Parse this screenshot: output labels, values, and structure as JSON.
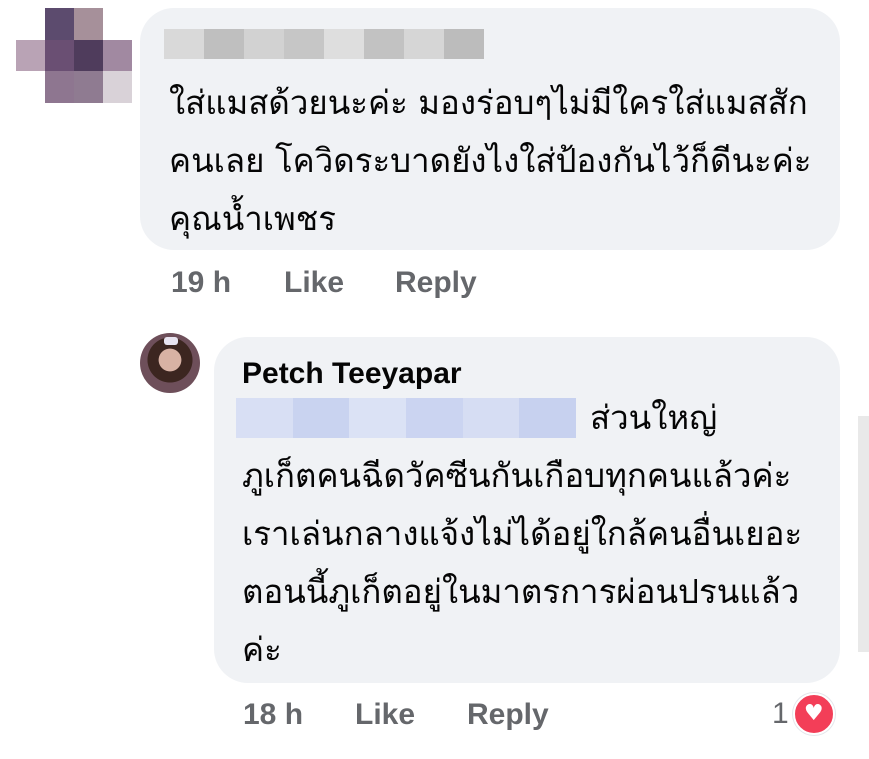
{
  "comment": {
    "text": "ใส่แมสด้วยนะค่ะ มองร่อบๆไม่มีใครใส่แมสสักคนเลย โควิดระบาดยังไงใส่ป้องกันไว้ก็ดีนะค่ะ คุณน้ำเพชร",
    "time": "19 h",
    "like_label": "Like",
    "reply_label": "Reply"
  },
  "reply": {
    "author": "Petch Teeyapar",
    "text_first_line": "ส่วนใหญ่",
    "text": "ภูเก็ตคนฉีดวัคซีนกันเกือบทุกคนแล้วค่ะเราเล่นกลางแจ้งไม่ได้อยู่ใกล้คนอื่นเยอะตอนนี้ภูเก็ตอยู่ในมาตรการผ่อนปรนแล้วค่ะ",
    "time": "18 h",
    "like_label": "Like",
    "reply_label": "Reply",
    "reaction_count": "1",
    "reaction_icon": "heart-icon"
  },
  "colors": {
    "bubble_bg": "#f0f2f5",
    "meta_text": "#65676b",
    "body_text": "#050505",
    "heart": "#f33e58"
  }
}
